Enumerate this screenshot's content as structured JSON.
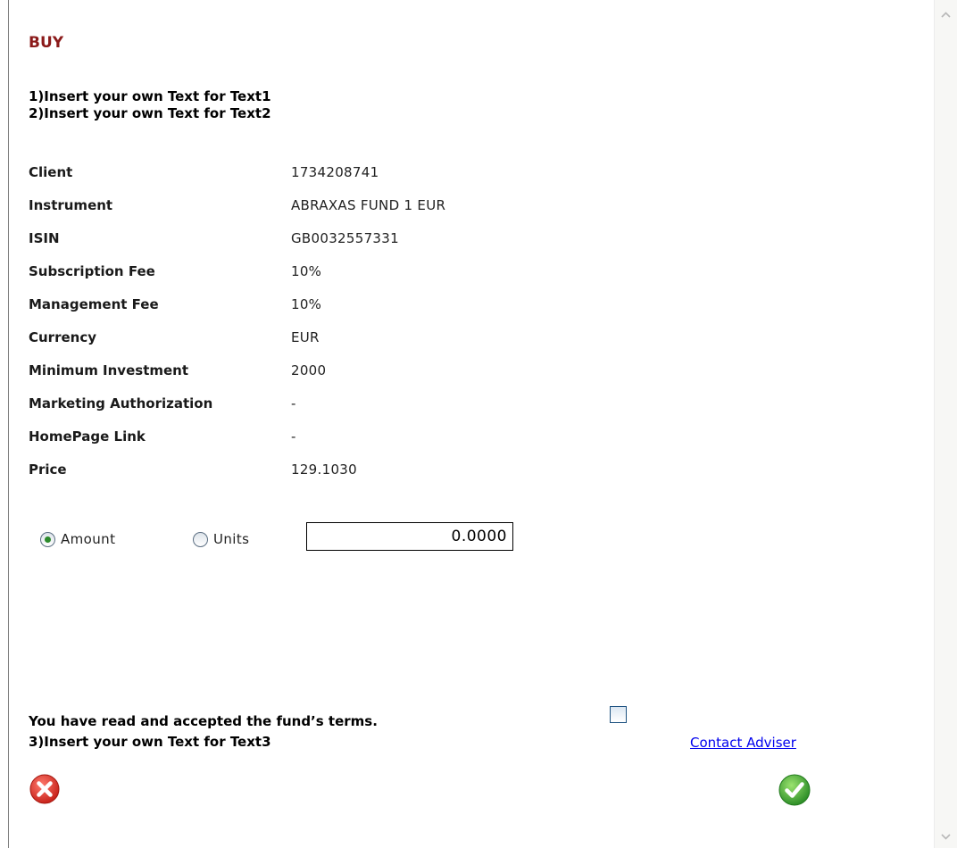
{
  "header": {
    "title": "BUY",
    "text1": "1)Insert your own Text for Text1",
    "text2": "2)Insert your own Text for Text2"
  },
  "details": [
    {
      "label": "Client",
      "value": "1734208741"
    },
    {
      "label": "Instrument",
      "value": "ABRAXAS FUND 1 EUR"
    },
    {
      "label": "ISIN",
      "value": "GB0032557331"
    },
    {
      "label": "Subscription Fee",
      "value": "10%"
    },
    {
      "label": "Management Fee",
      "value": "10%"
    },
    {
      "label": "Currency",
      "value": "EUR"
    },
    {
      "label": "Minimum Investment",
      "value": "2000"
    },
    {
      "label": "Marketing Authorization",
      "value": "-"
    },
    {
      "label": "HomePage Link",
      "value": "-"
    },
    {
      "label": "Price",
      "value": "129.1030"
    }
  ],
  "order": {
    "amount_label": "Amount",
    "units_label": "Units",
    "selected": "Amount",
    "quantity_value": "0.0000"
  },
  "footer": {
    "terms_text": "You have read and accepted the fund’s terms.",
    "terms_checked": false,
    "text3": "3)Insert your own Text for Text3",
    "contact_link": "Contact Adviser"
  },
  "icons": {
    "cancel": "cancel-icon",
    "confirm": "checkmark-icon",
    "scroll_up": "chevron-up-icon",
    "scroll_down": "chevron-down-icon"
  },
  "colors": {
    "title": "#8b1a1a",
    "cancel": "#d9342b",
    "confirm": "#3fa83a",
    "link": "#0000ee"
  }
}
